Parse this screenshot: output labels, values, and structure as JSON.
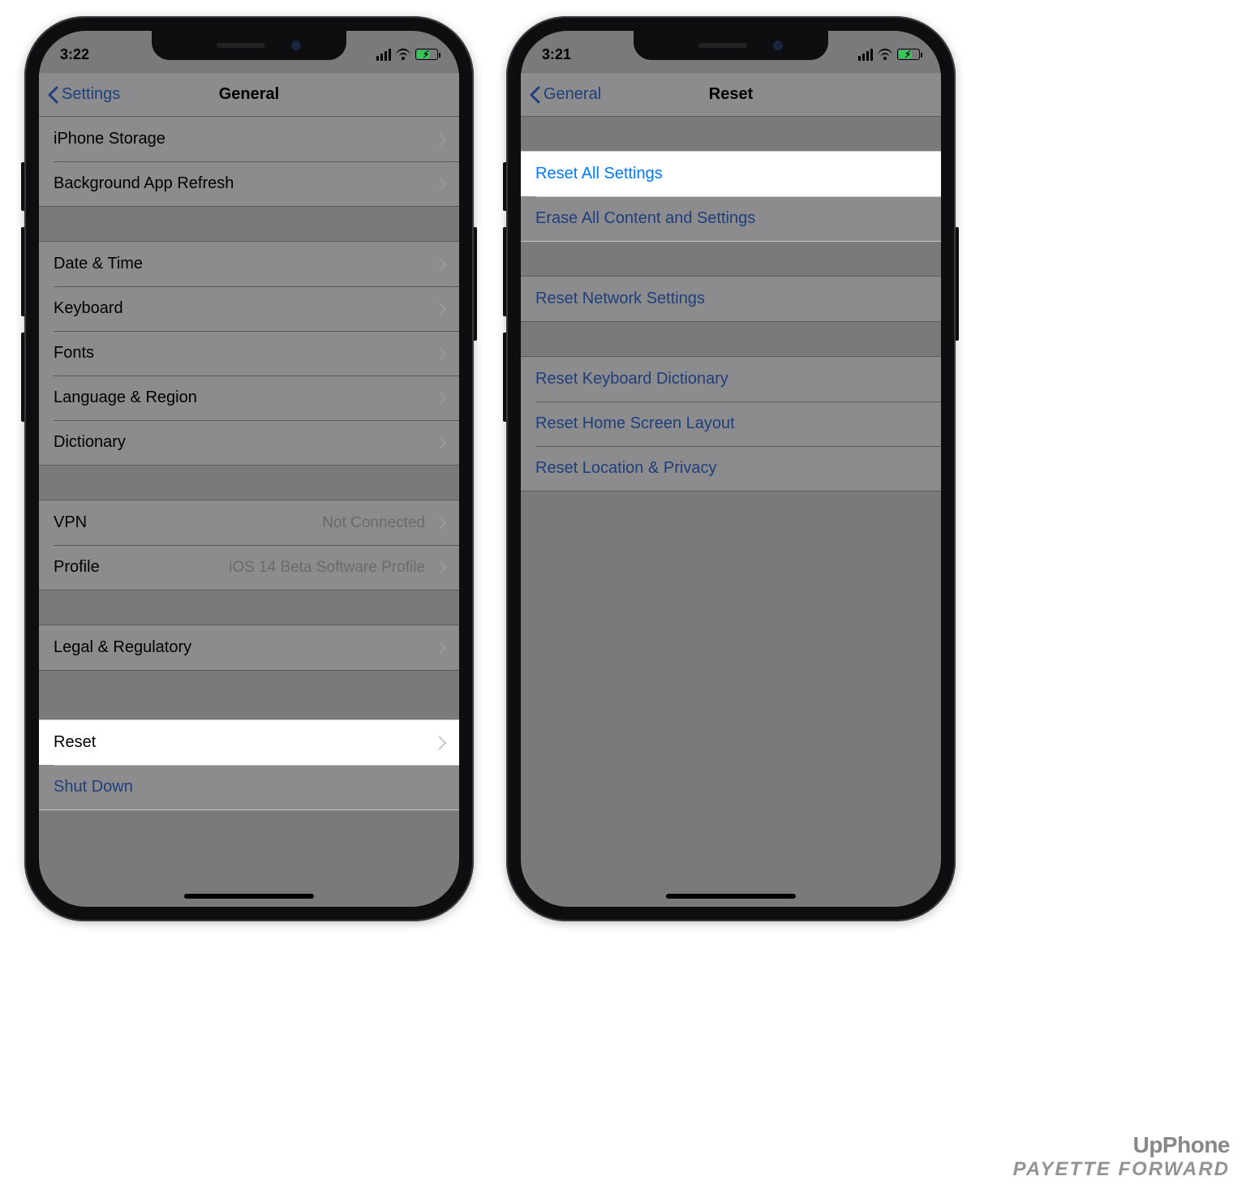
{
  "watermark": {
    "line1": "UpPhone",
    "line2": "PAYETTE FORWARD"
  },
  "phone_left": {
    "time": "3:22",
    "nav": {
      "back": "Settings",
      "title": "General"
    },
    "group1": [
      {
        "label": "iPhone Storage"
      },
      {
        "label": "Background App Refresh"
      }
    ],
    "group2": [
      {
        "label": "Date & Time"
      },
      {
        "label": "Keyboard"
      },
      {
        "label": "Fonts"
      },
      {
        "label": "Language & Region"
      },
      {
        "label": "Dictionary"
      }
    ],
    "group3": [
      {
        "label": "VPN",
        "detail": "Not Connected"
      },
      {
        "label": "Profile",
        "detail": "iOS 14 Beta Software Profile"
      }
    ],
    "group4": [
      {
        "label": "Legal & Regulatory"
      }
    ],
    "group5": [
      {
        "label": "Reset"
      },
      {
        "label": "Shut Down"
      }
    ]
  },
  "phone_right": {
    "time": "3:21",
    "nav": {
      "back": "General",
      "title": "Reset"
    },
    "group1": [
      {
        "label": "Reset All Settings"
      },
      {
        "label": "Erase All Content and Settings"
      }
    ],
    "group2": [
      {
        "label": "Reset Network Settings"
      }
    ],
    "group3": [
      {
        "label": "Reset Keyboard Dictionary"
      },
      {
        "label": "Reset Home Screen Layout"
      },
      {
        "label": "Reset Location & Privacy"
      }
    ]
  }
}
